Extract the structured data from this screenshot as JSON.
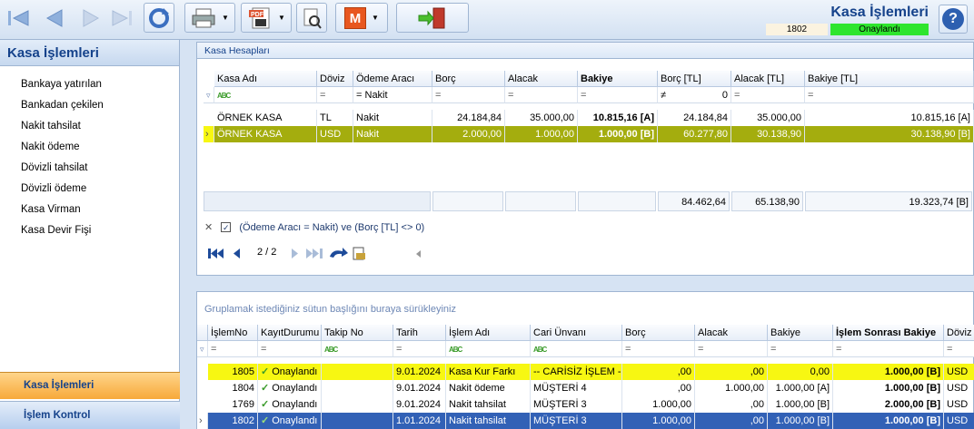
{
  "toolbar": {
    "icons": [
      "first-icon",
      "previous-icon",
      "next-icon",
      "last-icon",
      "refresh-icon",
      "print-icon",
      "pdf-icon",
      "tools-icon",
      "m-icon",
      "exit-icon"
    ],
    "pdf_label": "PDF",
    "m_label": "M"
  },
  "header": {
    "title": "Kasa İşlemleri",
    "doc_no": "1802",
    "status": "Onaylandı",
    "help_label": "?"
  },
  "sidebar": {
    "title": "Kasa İşlemleri",
    "items": [
      "Bankaya yatırılan",
      "Bankadan çekilen",
      "Nakit tahsilat",
      "Nakit ödeme",
      "Dövizli tahsilat",
      "Dövizli ödeme",
      "Kasa Virman",
      "Kasa Devir Fişi"
    ],
    "nav": [
      "Kasa İşlemleri",
      "İşlem Kontrol"
    ]
  },
  "panel1": {
    "title": "Kasa Hesapları",
    "columns": [
      "Kasa Adı",
      "Döviz",
      "Ödeme Aracı",
      "Borç",
      "Alacak",
      "Bakiye",
      "Borç [TL]",
      "Alacak [TL]",
      "Bakiye [TL]"
    ],
    "filter_row": {
      "odeme": "Nakit",
      "borc_tl": "0",
      "ne": "≠",
      "eq": "="
    },
    "rows": [
      {
        "kasa": "ÖRNEK KASA",
        "doviz": "TL",
        "odeme": "Nakit",
        "borc": "24.184,84",
        "alacak": "35.000,00",
        "bakiye": "10.815,16 [A]",
        "borc_tl": "24.184,84",
        "alacak_tl": "35.000,00",
        "bakiye_tl": "10.815,16 [A]"
      },
      {
        "kasa": "ÖRNEK KASA",
        "doviz": "USD",
        "odeme": "Nakit",
        "borc": "2.000,00",
        "alacak": "1.000,00",
        "bakiye": "1.000,00 [B]",
        "borc_tl": "60.277,80",
        "alacak_tl": "30.138,90",
        "bakiye_tl": "30.138,90 [B]"
      }
    ],
    "totals": {
      "borc_tl": "84.462,64",
      "alacak_tl": "65.138,90",
      "bakiye_tl": "19.323,74 [B]"
    },
    "filter_text": "(Ödeme Aracı = Nakit) ve (Borç [TL] <> 0)",
    "page": "2 / 2"
  },
  "panel2": {
    "group_hint": "Gruplamak istediğiniz sütun başlığını buraya sürükleyiniz",
    "columns": [
      "İşlemNo",
      "KayıtDurumu",
      "Takip No",
      "Tarih",
      "İşlem Adı",
      "Cari Ünvanı",
      "Borç",
      "Alacak",
      "Bakiye",
      "İşlem Sonrası Bakiye",
      "Döviz"
    ],
    "rows": [
      {
        "no": "1805",
        "durum": "Onaylandı",
        "tarih": "9.01.2024",
        "islem": "Kasa Kur Farkı",
        "cari": "-- CARİSİZ İŞLEM --",
        "borc": ",00",
        "alacak": ",00",
        "bakiye": "0,00",
        "sonra": "1.000,00 [B]",
        "doviz": "USD"
      },
      {
        "no": "1804",
        "durum": "Onaylandı",
        "tarih": "9.01.2024",
        "islem": "Nakit ödeme",
        "cari": "MÜŞTERİ 4",
        "borc": ",00",
        "alacak": "1.000,00",
        "bakiye": "1.000,00 [A]",
        "sonra": "1.000,00 [B]",
        "doviz": "USD"
      },
      {
        "no": "1769",
        "durum": "Onaylandı",
        "tarih": "9.01.2024",
        "islem": "Nakit tahsilat",
        "cari": "MÜŞTERİ 3",
        "borc": "1.000,00",
        "alacak": ",00",
        "bakiye": "1.000,00 [B]",
        "sonra": "2.000,00 [B]",
        "doviz": "USD"
      },
      {
        "no": "1802",
        "durum": "Onaylandı",
        "tarih": "1.01.2024",
        "islem": "Nakit tahsilat",
        "cari": "MÜŞTERİ 3",
        "borc": "1.000,00",
        "alacak": ",00",
        "bakiye": "1.000,00 [B]",
        "sonra": "1.000,00 [B]",
        "doviz": "USD"
      }
    ]
  },
  "colors": {
    "accent": "#15428b",
    "status_green": "#2ee52e",
    "selected_row": "#a4ad0e",
    "highlight_row": "#f7f712",
    "focused_row": "#3261b6"
  }
}
